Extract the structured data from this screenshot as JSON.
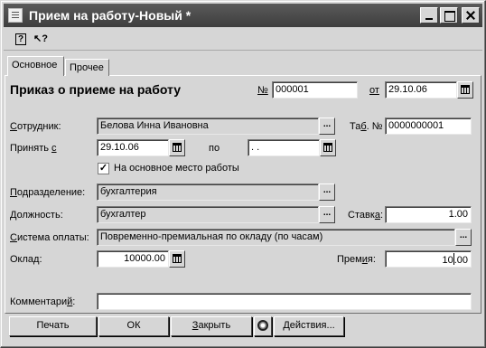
{
  "window": {
    "title": "Прием на работу-Новый *",
    "controls": [
      "minimize-icon",
      "maximize-icon",
      "close-icon"
    ]
  },
  "toolbar": {
    "help_icon": "?",
    "context_help_icon": "↖?"
  },
  "tabs": [
    {
      "label": "Основное",
      "active": true
    },
    {
      "label": "Прочее",
      "active": false
    }
  ],
  "form": {
    "heading": "Приказ о приеме на работу",
    "number_label": "№",
    "number_value": "000001",
    "from_label": "от",
    "date_value": "29.10.06",
    "employee_label": "Сотрудник:",
    "employee_value": "Белова Инна Ивановна",
    "tab_no_label": "Таб. №",
    "tab_no_value": "0000000001",
    "hire_from_label": "Принять с",
    "hire_from_value": "29.10.06",
    "to_label": "по",
    "to_value": " .  .",
    "main_place_checked": true,
    "main_place_label": "На основное место работы",
    "department_label": "Подразделение:",
    "department_value": "бухгалтерия",
    "position_label": "Должность:",
    "position_value": "бухгалтер",
    "rate_label": "Ставка:",
    "rate_value": "1.00",
    "pay_system_label": "Система оплаты:",
    "pay_system_value": "Повременно-премиальная по окладу (по часам)",
    "salary_label": "Оклад:",
    "salary_value": "10000.00",
    "bonus_label": "Премия:",
    "bonus_value": "10",
    "bonus_value_after_caret": ".00",
    "comment_label": "Комментарий:",
    "comment_value": ""
  },
  "buttons": {
    "print": "Печать",
    "ok": "ОК",
    "close": "Закрыть",
    "actions": "Действия..."
  },
  "colors": {
    "window_bg": "#d6d6d6",
    "titlebar": "#4a4a4a",
    "field_bg": "#ffffff"
  }
}
